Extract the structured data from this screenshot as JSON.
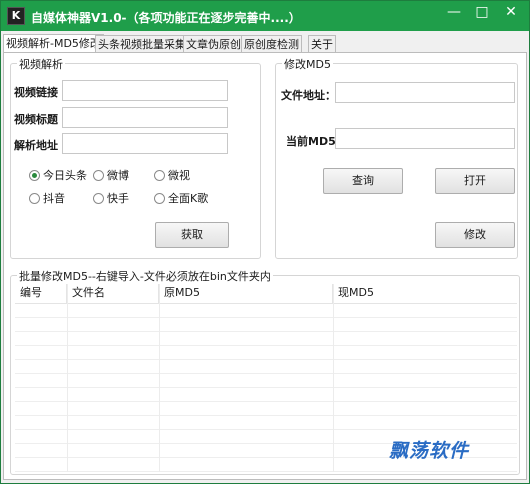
{
  "window": {
    "title": "自媒体神器V1.0-（各项功能正在逐步完善中....）",
    "app_icon": "K",
    "minimize": "—",
    "maximize": "□",
    "close": "✕"
  },
  "tabs": [
    {
      "label": "视频解析-MD5修改"
    },
    {
      "label": "头条视频批量采集"
    },
    {
      "label": "文章伪原创"
    },
    {
      "label": "原创度检测"
    },
    {
      "label": "关于"
    }
  ],
  "video_parse": {
    "group_title": "视频解析",
    "link_label": "视频链接",
    "title_label": "视频标题",
    "address_label": "解析地址",
    "link_value": "",
    "title_value": "",
    "address_value": "",
    "platforms": [
      {
        "label": "今日头条",
        "checked": true
      },
      {
        "label": "微博",
        "checked": false
      },
      {
        "label": "微视",
        "checked": false
      },
      {
        "label": "抖音",
        "checked": false
      },
      {
        "label": "快手",
        "checked": false
      },
      {
        "label": "全面K歌",
        "checked": false
      }
    ],
    "fetch_button": "获取"
  },
  "md5_edit": {
    "group_title": "修改MD5",
    "file_label": "文件地址：",
    "current_label": "当前MD5：",
    "file_value": "",
    "current_value": "",
    "query_button": "查询",
    "open_button": "打开",
    "modify_button": "修改"
  },
  "batch": {
    "group_title": "批量修改MD5--右键导入-文件必须放在bin文件夹内",
    "columns": [
      "编号",
      "文件名",
      "原MD5",
      "现MD5"
    ]
  },
  "watermark": "飘荡软件"
}
